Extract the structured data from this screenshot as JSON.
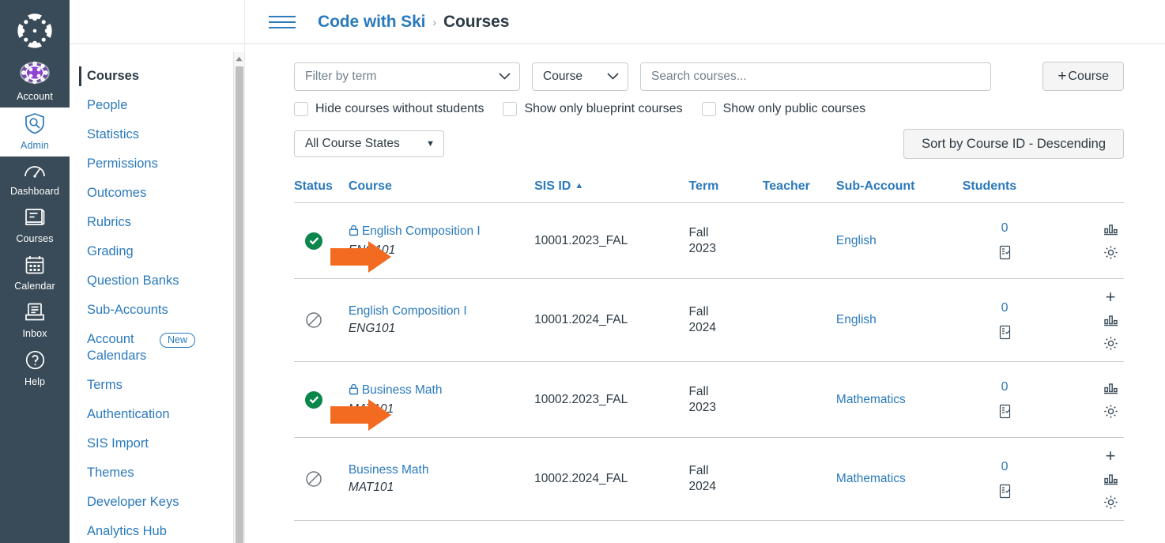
{
  "colors": {
    "brand": "#2B7ABC",
    "navbg": "#394B58",
    "published_green": "#0B874B",
    "annotation_orange": "#F26B21",
    "text": "#2D3B45",
    "border": "#C7CDD1"
  },
  "global_nav": {
    "logo_icon": "canvas-logo-icon",
    "items": [
      {
        "label": "Account",
        "icon": "avatar-icon",
        "active": false
      },
      {
        "label": "Admin",
        "icon": "shield-key-icon",
        "active": true
      },
      {
        "label": "Dashboard",
        "icon": "gauge-icon",
        "active": false
      },
      {
        "label": "Courses",
        "icon": "book-icon",
        "active": false
      },
      {
        "label": "Calendar",
        "icon": "calendar-icon",
        "active": false
      },
      {
        "label": "Inbox",
        "icon": "inbox-icon",
        "active": false
      },
      {
        "label": "Help",
        "icon": "question-circle-icon",
        "active": false
      }
    ]
  },
  "sub_nav": {
    "items": [
      {
        "label": "Courses",
        "active": true
      },
      {
        "label": "People",
        "active": false
      },
      {
        "label": "Statistics",
        "active": false
      },
      {
        "label": "Permissions",
        "active": false
      },
      {
        "label": "Outcomes",
        "active": false
      },
      {
        "label": "Rubrics",
        "active": false
      },
      {
        "label": "Grading",
        "active": false
      },
      {
        "label": "Question Banks",
        "active": false
      },
      {
        "label": "Sub-Accounts",
        "active": false
      },
      {
        "label": "Account Calendars",
        "active": false,
        "badge": "New"
      },
      {
        "label": "Terms",
        "active": false
      },
      {
        "label": "Authentication",
        "active": false
      },
      {
        "label": "SIS Import",
        "active": false
      },
      {
        "label": "Themes",
        "active": false
      },
      {
        "label": "Developer Keys",
        "active": false
      },
      {
        "label": "Analytics Hub",
        "active": false
      }
    ]
  },
  "header": {
    "menu_icon": "hamburger-icon",
    "breadcrumb_root": "Code with Ski",
    "breadcrumb_separator": "›",
    "breadcrumb_current": "Courses"
  },
  "toolbar": {
    "term_filter_placeholder": "Filter by term",
    "search_type_value": "Course",
    "search_placeholder": "Search courses...",
    "add_course_plus": "+",
    "add_course_label": "Course",
    "checkbox_hide_no_students": "Hide courses without students",
    "checkbox_blueprint_only": "Show only blueprint courses",
    "checkbox_public_only": "Show only public courses",
    "course_states_value": "All Course States",
    "sort_button_label": "Sort by Course ID - Descending"
  },
  "table": {
    "headers": {
      "status": "Status",
      "course": "Course",
      "sis_id": "SIS ID",
      "sis_sort_arrow": "▲",
      "term": "Term",
      "teacher": "Teacher",
      "sub_account": "Sub-Account",
      "students": "Students"
    },
    "rows": [
      {
        "status": "published",
        "status_icon": "check-circle-icon",
        "blueprint_locked": true,
        "course_name": "English Composition I",
        "course_code": "ENG101",
        "sis_id": "10001.2023_FAL",
        "term": "Fall 2023",
        "teacher": "",
        "sub_account": "English",
        "students": "0",
        "show_add_user": false,
        "annotated": true
      },
      {
        "status": "unpublished",
        "status_icon": "no-entry-circle-icon",
        "blueprint_locked": false,
        "course_name": "English Composition I",
        "course_code": "ENG101",
        "sis_id": "10001.2024_FAL",
        "term": "Fall 2024",
        "teacher": "",
        "sub_account": "English",
        "students": "0",
        "show_add_user": true,
        "annotated": false
      },
      {
        "status": "published",
        "status_icon": "check-circle-icon",
        "blueprint_locked": true,
        "course_name": "Business Math",
        "course_code": "MAT101",
        "sis_id": "10002.2023_FAL",
        "term": "Fall 2023",
        "teacher": "",
        "sub_account": "Mathematics",
        "students": "0",
        "show_add_user": false,
        "annotated": true
      },
      {
        "status": "unpublished",
        "status_icon": "no-entry-circle-icon",
        "blueprint_locked": false,
        "course_name": "Business Math",
        "course_code": "MAT101",
        "sis_id": "10002.2024_FAL",
        "term": "Fall 2024",
        "teacher": "",
        "sub_account": "Mathematics",
        "students": "0",
        "show_add_user": true,
        "annotated": false
      }
    ],
    "row_action_icons": {
      "add_user": "plus-icon",
      "statistics": "bar-chart-icon",
      "settings": "gear-icon",
      "students_roster": "roster-icon"
    }
  }
}
